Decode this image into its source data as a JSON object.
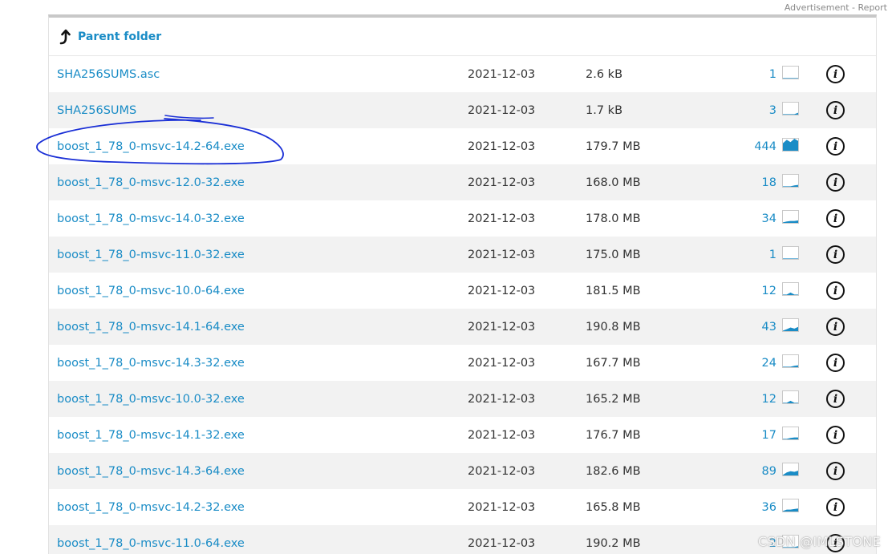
{
  "ad_report": {
    "advertisement": "Advertisement",
    "separator": " - ",
    "report": "Report"
  },
  "parent_folder": {
    "label": "Parent folder",
    "icon": "turn-up-arrow-icon"
  },
  "colors": {
    "link": "#1a8cc6",
    "row_alt": "#f2f2f2",
    "annotation": "#1a2fd6"
  },
  "files": [
    {
      "name": "SHA256SUMS.asc",
      "date": "2021-12-03",
      "size": "2.6 kB",
      "downloads": "1",
      "activity": [
        0,
        0,
        0,
        0,
        0
      ]
    },
    {
      "name": "SHA256SUMS",
      "date": "2021-12-03",
      "size": "1.7 kB",
      "downloads": "3",
      "activity": [
        0,
        0,
        0,
        0,
        0.1
      ]
    },
    {
      "name": "boost_1_78_0-msvc-14.2-64.exe",
      "date": "2021-12-03",
      "size": "179.7 MB",
      "downloads": "444",
      "activity": [
        0.6,
        0.9,
        0.7,
        1,
        0.8
      ]
    },
    {
      "name": "boost_1_78_0-msvc-12.0-32.exe",
      "date": "2021-12-03",
      "size": "168.0 MB",
      "downloads": "18",
      "activity": [
        0,
        0,
        0,
        0.05,
        0.1
      ]
    },
    {
      "name": "boost_1_78_0-msvc-14.0-32.exe",
      "date": "2021-12-03",
      "size": "178.0 MB",
      "downloads": "34",
      "activity": [
        0,
        0.05,
        0.1,
        0.1,
        0.15
      ]
    },
    {
      "name": "boost_1_78_0-msvc-11.0-32.exe",
      "date": "2021-12-03",
      "size": "175.0 MB",
      "downloads": "1",
      "activity": [
        0,
        0,
        0,
        0,
        0
      ]
    },
    {
      "name": "boost_1_78_0-msvc-10.0-64.exe",
      "date": "2021-12-03",
      "size": "181.5 MB",
      "downloads": "12",
      "activity": [
        0,
        0,
        0.15,
        0,
        0
      ]
    },
    {
      "name": "boost_1_78_0-msvc-14.1-64.exe",
      "date": "2021-12-03",
      "size": "190.8 MB",
      "downloads": "43",
      "activity": [
        0,
        0.1,
        0.25,
        0.15,
        0.3
      ]
    },
    {
      "name": "boost_1_78_0-msvc-14.3-32.exe",
      "date": "2021-12-03",
      "size": "167.7 MB",
      "downloads": "24",
      "activity": [
        0,
        0,
        0,
        0.05,
        0.1
      ]
    },
    {
      "name": "boost_1_78_0-msvc-10.0-32.exe",
      "date": "2021-12-03",
      "size": "165.2 MB",
      "downloads": "12",
      "activity": [
        0,
        0,
        0.15,
        0,
        0
      ]
    },
    {
      "name": "boost_1_78_0-msvc-14.1-32.exe",
      "date": "2021-12-03",
      "size": "176.7 MB",
      "downloads": "17",
      "activity": [
        0,
        0,
        0.05,
        0.1,
        0.1
      ]
    },
    {
      "name": "boost_1_78_0-msvc-14.3-64.exe",
      "date": "2021-12-03",
      "size": "182.6 MB",
      "downloads": "89",
      "activity": [
        0,
        0.2,
        0.3,
        0.25,
        0.35
      ]
    },
    {
      "name": "boost_1_78_0-msvc-14.2-32.exe",
      "date": "2021-12-03",
      "size": "165.8 MB",
      "downloads": "36",
      "activity": [
        0,
        0.1,
        0.1,
        0.15,
        0.2
      ]
    },
    {
      "name": "boost_1_78_0-msvc-11.0-64.exe",
      "date": "2021-12-03",
      "size": "190.2 MB",
      "downloads": "2",
      "activity": [
        0,
        0,
        0,
        0,
        0.05
      ]
    }
  ],
  "watermark": "CSDN @IMLSTONE"
}
